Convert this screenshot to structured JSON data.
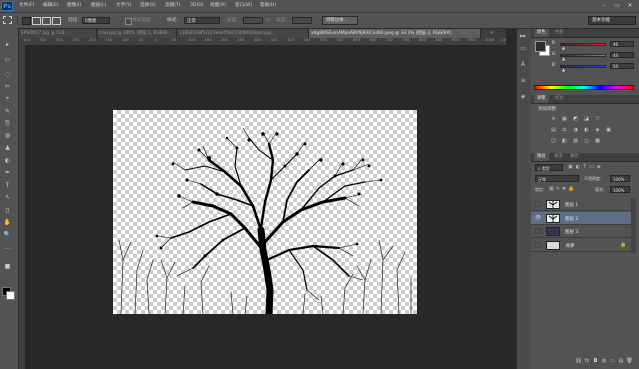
{
  "app": {
    "logo": "Ps"
  },
  "menu": [
    "文件(F)",
    "编辑(E)",
    "图像(I)",
    "图层(L)",
    "文字(Y)",
    "选择(S)",
    "滤镜(T)",
    "3D(D)",
    "视图(V)",
    "窗口(W)",
    "帮助(H)"
  ],
  "window_controls": [
    "–",
    "▭",
    "✕"
  ],
  "options": {
    "feather_label": "羽化:",
    "feather_value": "0像素",
    "antialias_label": "消除锯齿",
    "style_label": "样式:",
    "style_value": "正常",
    "width_label": "宽度:",
    "height_label": "高度:",
    "refine_edge_button": "调整边缘...",
    "workspace": "基本功能"
  },
  "tabs": [
    "EPSON17.jpg @ 100...",
    "true.jpg @ 100% (图层 1, RGB/8...",
    "11893419f52c11eaef5947c80b01b0ad.jpg...",
    "xRg8KISFumAMpoABV9jRAICns68.jpeg @ 33.3% (图层 2, RGB/8#)"
  ],
  "ruler_ticks": [
    "400",
    "350",
    "300",
    "250",
    "200",
    "150",
    "100",
    "50",
    "0",
    "50",
    "100",
    "150",
    "200",
    "250",
    "300",
    "350",
    "400",
    "450",
    "500",
    "550",
    "600",
    "650",
    "700",
    "750",
    "800",
    "850",
    "900",
    "950",
    "1000",
    "1050"
  ],
  "color_panel": {
    "tabs": [
      "颜色",
      "色板"
    ],
    "channels": [
      {
        "label": "R",
        "value": "46",
        "color": "#e03030"
      },
      {
        "label": "G",
        "value": "44",
        "color": "#30c030"
      },
      {
        "label": "B",
        "value": "50",
        "color": "#3040e0"
      }
    ],
    "foreground_color": "#2e2c32",
    "background_color": "#ffffff"
  },
  "adjustments_panel": {
    "tabs": [
      "调整",
      "样式"
    ],
    "title": "添加调整",
    "icons_row1": [
      "☀",
      "▦",
      "◩",
      "◪",
      "▽"
    ],
    "icons_row2": [
      "▤",
      "⚖",
      "◑",
      "◐",
      "◈",
      "▣"
    ],
    "icons_row3": [
      "◫",
      "◧",
      "▨",
      "◻",
      "▩"
    ]
  },
  "layers_panel": {
    "tabs": [
      "图层",
      "通道",
      "路径"
    ],
    "kind_label": "类型",
    "blend_mode": "正常",
    "opacity_label": "不透明度:",
    "opacity_value": "100%",
    "lock_label": "锁定:",
    "fill_label": "填充:",
    "fill_value": "100%",
    "layers": [
      {
        "name": "图层 1",
        "selected": false,
        "visible": false,
        "thumb_color": "#e8e8e8"
      },
      {
        "name": "图层 2",
        "selected": true,
        "visible": true,
        "thumb_color": "#f0f0f0"
      },
      {
        "name": "图层 3",
        "selected": false,
        "visible": false,
        "thumb_color": "#3a3550"
      },
      {
        "name": "背景",
        "selected": false,
        "visible": false,
        "thumb_color": "#d8d8d8"
      }
    ],
    "bottom_icons": [
      "⛓",
      "fx",
      "◘",
      "◍",
      "▭",
      "▤",
      "🗑"
    ]
  },
  "tools": [
    "▸",
    "▭",
    "◌",
    "✂",
    "⌖",
    "✎",
    "⎘",
    "◍",
    "▲",
    "◐",
    "✒",
    "T",
    "↖",
    "▯",
    "✋",
    "🔍",
    "…",
    "■"
  ],
  "side_icons": [
    "▶▶",
    "▭",
    "A",
    "≡",
    "◈"
  ],
  "colors": {
    "accent": "#2d7ad6",
    "selection": "#5d6e85"
  }
}
